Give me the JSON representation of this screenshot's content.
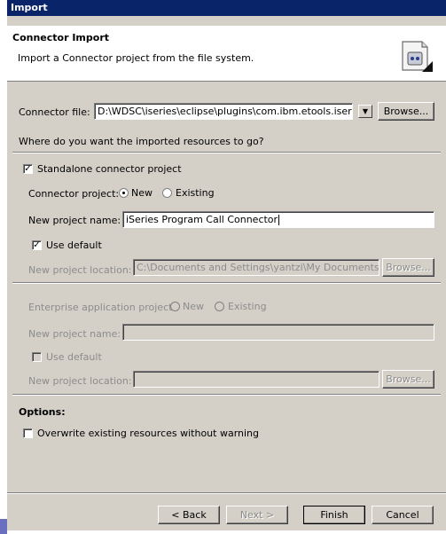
{
  "window": {
    "title": "Import"
  },
  "banner": {
    "title": "Connector Import",
    "description": "Import a Connector project from the file system."
  },
  "connector_file": {
    "label": "Connector file:",
    "value": "D:\\WDSC\\iseries\\eclipse\\plugins\\com.ibm.etools.iseries.we",
    "browse": "Browse..."
  },
  "destination_question": "Where do you want the imported resources to go?",
  "standalone": {
    "label": "Standalone connector project",
    "checked": true,
    "project_label": "Connector project:",
    "new_label": "New",
    "existing_label": "Existing",
    "selected": "New",
    "name_label": "New project name:",
    "name_value": "iSeries Program Call Connector",
    "use_default_label": "Use default",
    "use_default_checked": true,
    "location_label": "New project location:",
    "location_value": "C:\\Documents and Settings\\yantzi\\My Documents\\IB",
    "browse": "Browse..."
  },
  "enterprise": {
    "label": "Enterprise application project:",
    "new_label": "New",
    "existing_label": "Existing",
    "name_label": "New project name:",
    "name_value": "",
    "use_default_label": "Use default",
    "location_label": "New project location:",
    "location_value": "",
    "browse": "Browse..."
  },
  "options": {
    "title": "Options:",
    "overwrite_label": "Overwrite existing resources without warning",
    "overwrite_checked": false
  },
  "buttons": {
    "back": "< Back",
    "next": "Next >",
    "finish": "Finish",
    "cancel": "Cancel"
  },
  "icons": {
    "wizard": "import-wizard-icon",
    "dropdown": "chevron-down-icon",
    "checkmark": "checkmark-icon"
  },
  "colors": {
    "titlebar": "#0a246a",
    "dialog": "#d4d0c8",
    "disabled_text": "#8c8c8c"
  }
}
